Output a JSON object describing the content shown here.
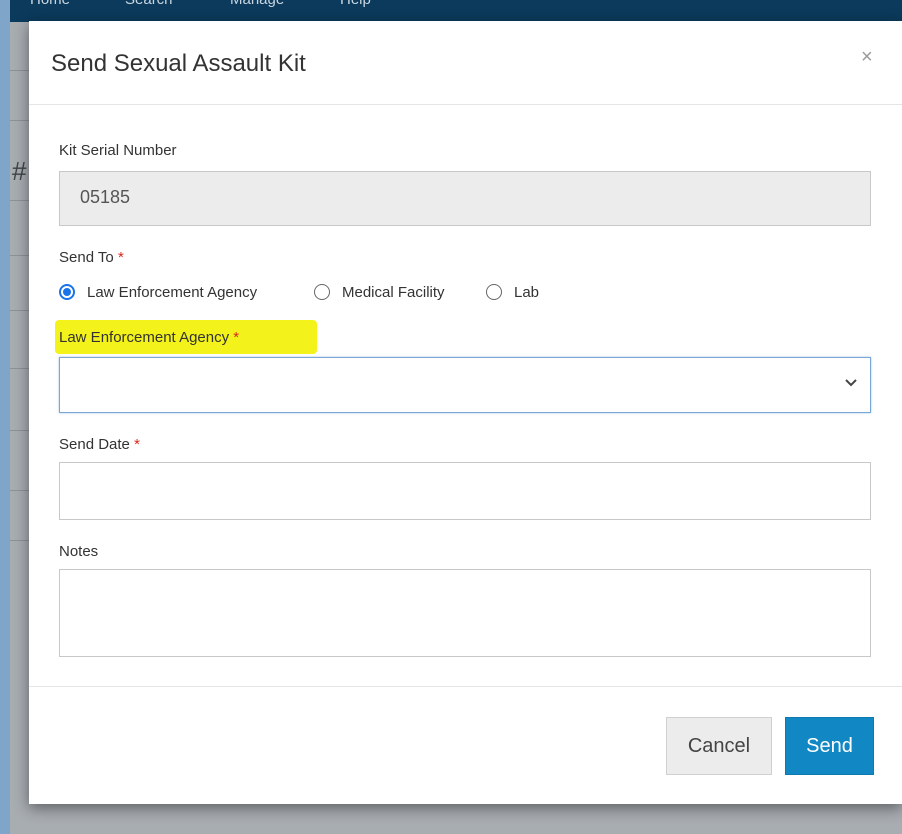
{
  "background": {
    "nav_items": [
      "Home",
      "Search",
      "Manage",
      "Help"
    ],
    "hash_char": "#"
  },
  "modal": {
    "title": "Send Sexual Assault Kit",
    "close_symbol": "×",
    "serial": {
      "label": "Kit Serial Number",
      "value": "05185"
    },
    "send_to": {
      "label": "Send To",
      "required_mark": "*",
      "options": [
        {
          "label": "Law Enforcement Agency",
          "checked": true
        },
        {
          "label": "Medical Facility",
          "checked": false
        },
        {
          "label": "Lab",
          "checked": false
        }
      ]
    },
    "agency": {
      "label": "Law Enforcement Agency",
      "required_mark": "*",
      "value": "",
      "highlight_color": "#f4f21b"
    },
    "send_date": {
      "label": "Send Date",
      "required_mark": "*",
      "value": ""
    },
    "notes": {
      "label": "Notes",
      "value": ""
    },
    "buttons": {
      "cancel": "Cancel",
      "send": "Send"
    }
  },
  "colors": {
    "primary": "#1188c4",
    "required": "#d9261c",
    "radio_checked": "#1a73e8",
    "navbar": "#0b3a5c"
  }
}
